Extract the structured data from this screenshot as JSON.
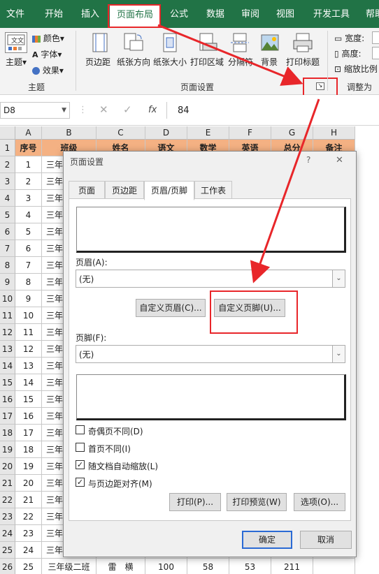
{
  "tabs": [
    "文件",
    "开始",
    "插入",
    "页面布局",
    "公式",
    "数据",
    "审阅",
    "视图",
    "开发工具",
    "帮助"
  ],
  "ribbon": {
    "theme": "主题",
    "colors": "颜色",
    "fonts": "字体",
    "effects": "效果",
    "margins": "页边距",
    "orientation": "纸张方向",
    "size": "纸张大小",
    "print_area": "打印区域",
    "breaks": "分隔符",
    "background": "背景",
    "print_titles": "打印标题",
    "width": "宽度:",
    "height": "高度:",
    "scale": "缩放比例",
    "group_theme": "主题",
    "group_page_setup": "页面设置",
    "group_scale": "调整为合"
  },
  "formula_bar": {
    "name_box": "D8",
    "value": "84",
    "fx": "fx"
  },
  "columns": [
    "A",
    "B",
    "C",
    "D",
    "E",
    "F",
    "G",
    "H"
  ],
  "header_row": [
    "序号",
    "班级",
    "姓名",
    "语文",
    "数学",
    "英语",
    "总分",
    "备注"
  ],
  "rows": [
    {
      "n": "1",
      "a": "1",
      "b": "三年"
    },
    {
      "n": "2",
      "a": "2",
      "b": "三年"
    },
    {
      "n": "3",
      "a": "3",
      "b": "三年"
    },
    {
      "n": "4",
      "a": "4",
      "b": "三年"
    },
    {
      "n": "5",
      "a": "5",
      "b": "三年"
    },
    {
      "n": "6",
      "a": "6",
      "b": "三年"
    },
    {
      "n": "7",
      "a": "7",
      "b": "三年"
    },
    {
      "n": "8",
      "a": "8",
      "b": "三年"
    },
    {
      "n": "9",
      "a": "9",
      "b": "三年"
    },
    {
      "n": "10",
      "a": "10",
      "b": "三年"
    },
    {
      "n": "11",
      "a": "11",
      "b": "三年"
    },
    {
      "n": "12",
      "a": "12",
      "b": "三年"
    },
    {
      "n": "13",
      "a": "13",
      "b": "三年"
    },
    {
      "n": "14",
      "a": "14",
      "b": "三年"
    },
    {
      "n": "15",
      "a": "15",
      "b": "三年"
    },
    {
      "n": "16",
      "a": "16",
      "b": "三年"
    },
    {
      "n": "17",
      "a": "17",
      "b": "三年"
    },
    {
      "n": "18",
      "a": "18",
      "b": "三年"
    },
    {
      "n": "19",
      "a": "19",
      "b": "三年"
    },
    {
      "n": "20",
      "a": "20",
      "b": "三年"
    },
    {
      "n": "21",
      "a": "21",
      "b": "三年"
    },
    {
      "n": "22",
      "a": "22",
      "b": "三年"
    },
    {
      "n": "23",
      "a": "23",
      "b": "三年"
    },
    {
      "n": "24",
      "a": "24",
      "b": "三年"
    }
  ],
  "last_row": {
    "n": "26",
    "a": "25",
    "b": "三年级二班",
    "c": "雷　横",
    "d": "100",
    "e": "58",
    "f": "53",
    "g": "211"
  },
  "row_numbers": [
    "1",
    "2",
    "3",
    "4",
    "5",
    "6",
    "7",
    "8",
    "9",
    "10",
    "11",
    "12",
    "13",
    "14",
    "15",
    "16",
    "17",
    "18",
    "19",
    "20",
    "21",
    "22",
    "23",
    "24",
    "25",
    "26"
  ],
  "dialog": {
    "title": "页面设置",
    "help": "?",
    "close": "✕",
    "tabs": [
      "页面",
      "页边距",
      "页眉/页脚",
      "工作表"
    ],
    "header_label": "页眉(A):",
    "header_value": "(无)",
    "custom_header": "自定义页眉(C)...",
    "custom_footer": "自定义页脚(U)...",
    "footer_label": "页脚(F):",
    "footer_value": "(无)",
    "chk_odd_even": "奇偶页不同(D)",
    "chk_first": "首页不同(I)",
    "chk_scale": "随文档自动缩放(L)",
    "chk_align": "与页边距对齐(M)",
    "print": "打印(P)...",
    "preview": "打印预览(W)",
    "options": "选项(O)...",
    "ok": "确定",
    "cancel": "取消"
  },
  "accent": "#217346",
  "highlight": "#e8262a"
}
